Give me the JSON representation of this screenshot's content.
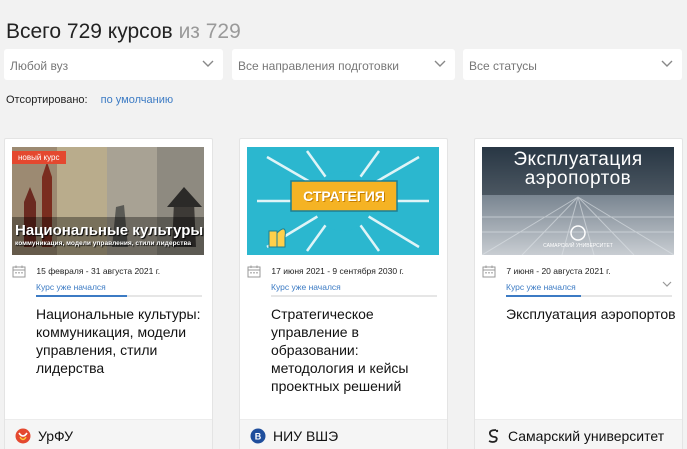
{
  "header": {
    "title_main": "Всего 729 курсов",
    "title_total": "из 729"
  },
  "filters": [
    {
      "label": "Любой вуз",
      "icon": "chevron-down-icon"
    },
    {
      "label": "Все направления подготовки",
      "icon": "chevron-down-icon"
    },
    {
      "label": "Все статусы",
      "icon": "chevron-down-icon"
    }
  ],
  "sort": {
    "label": "Отсортировано:",
    "value": "по умолчанию"
  },
  "colors": {
    "accent": "#3c7bc4",
    "badge": "#e4482f",
    "background": "#f2f2f2"
  },
  "cards": [
    {
      "badge": "новый курс",
      "cover_title": "Национальные культуры:",
      "cover_subtitle": "коммуникация, модели управления, стили лидерства",
      "dates": "15 февраля - 31 августа 2021 г.",
      "status": "Курс уже начался",
      "progress": 0.55,
      "name": "Национальные культуры: коммуникация, модели управления, стили лидерства",
      "university": "УрФУ",
      "logo_icon": "urfu-logo-icon"
    },
    {
      "cover_title": "СТРАТЕГИЯ",
      "dates": "17 июня 2021 - 9 сентября 2030 г.",
      "status": "Курс уже начался",
      "progress": 0.0,
      "name": "Стратегическое управление в образовании: методология и кейсы проектных решений",
      "university": "НИУ ВШЭ",
      "logo_icon": "hse-logo-icon"
    },
    {
      "cover_title": "Эксплуатация аэропортов",
      "cover_logo_text": "САМАРСКИЙ УНИВЕРСИТЕТ",
      "dates": "7 июня - 20 августа 2021 г.",
      "status": "Курс уже начался",
      "progress": 0.45,
      "name": "Эксплуатация аэропортов",
      "university": "Самарский университет",
      "logo_icon": "samara-logo-icon"
    }
  ]
}
